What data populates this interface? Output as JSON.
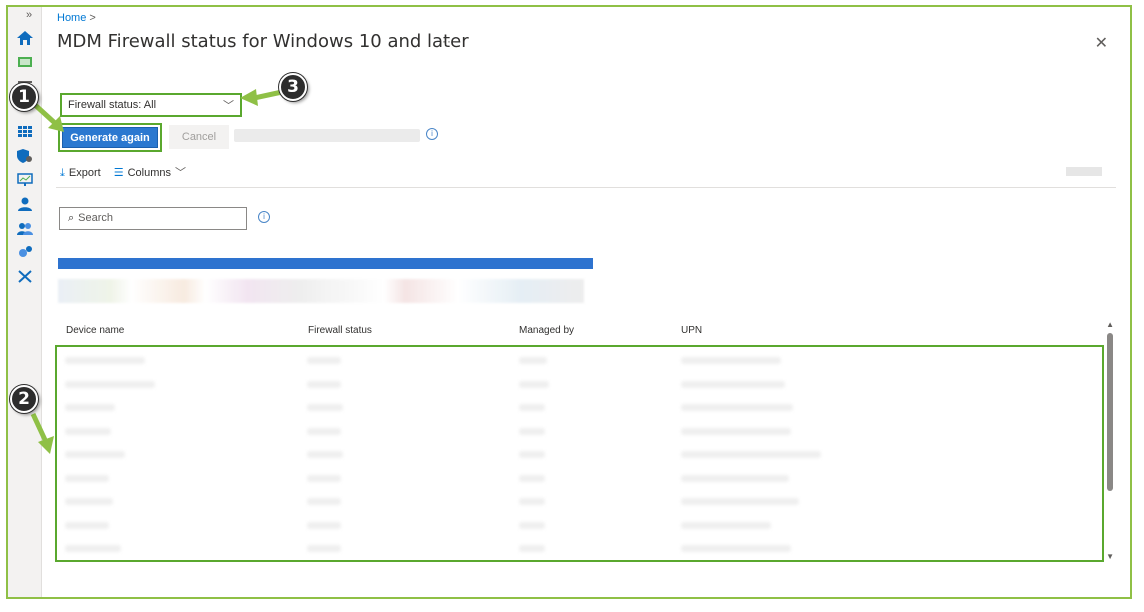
{
  "breadcrumb": {
    "home": "Home",
    "separator": ">"
  },
  "page": {
    "title": "MDM Firewall status for Windows 10 and later",
    "more": "···",
    "close": "✕"
  },
  "filter": {
    "label": "Firewall status: All"
  },
  "actions": {
    "generate": "Generate again",
    "cancel": "Cancel"
  },
  "toolbar": {
    "export": "Export",
    "columns": "Columns"
  },
  "search": {
    "placeholder": "Search"
  },
  "table": {
    "columns": [
      "Device name",
      "Firewall status",
      "Managed by",
      "UPN"
    ]
  },
  "callouts": [
    "1",
    "2",
    "3"
  ],
  "colors": {
    "accent": "#2b78d0",
    "annotation": "#8fc046",
    "badge": "#2d2d2d"
  }
}
